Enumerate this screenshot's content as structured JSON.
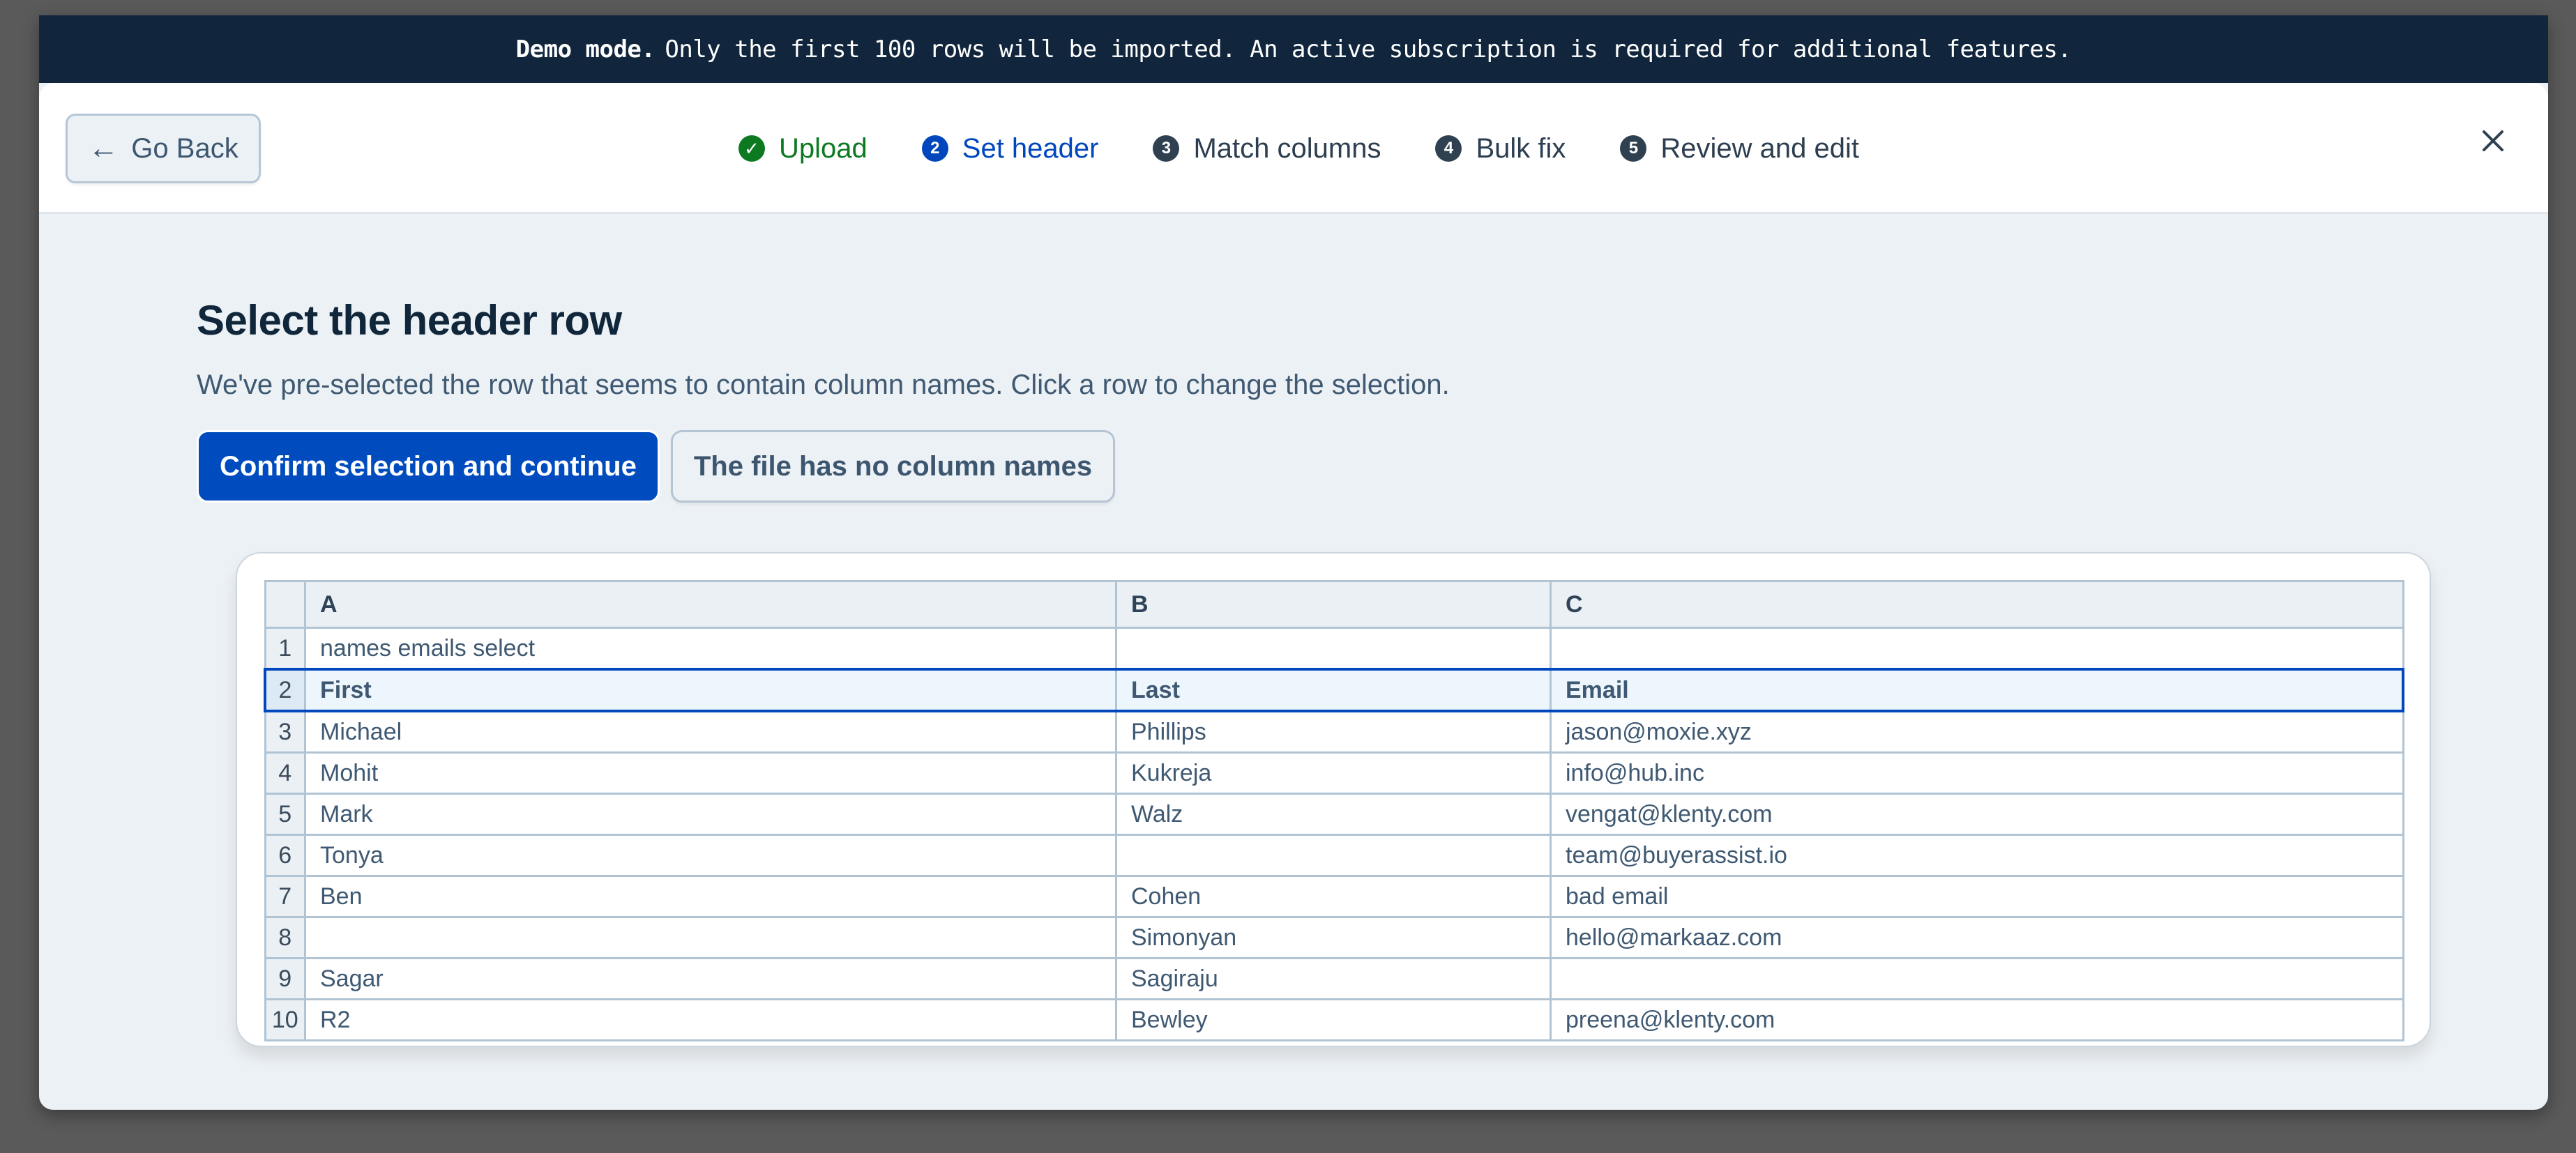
{
  "banner": {
    "bold": "Demo mode.",
    "text": "Only the first 100 rows will be imported. An active subscription is required for additional features."
  },
  "header": {
    "back_button": {
      "label": "Go Back",
      "icon": "arrow-left-icon"
    },
    "close_button": {
      "icon": "close-icon"
    },
    "steps": [
      {
        "number": "1",
        "label": "Upload",
        "status": "done",
        "icon": "check-circle-icon"
      },
      {
        "number": "2",
        "label": "Set header",
        "status": "active"
      },
      {
        "number": "3",
        "label": "Match columns",
        "status": "todo"
      },
      {
        "number": "4",
        "label": "Bulk fix",
        "status": "todo"
      },
      {
        "number": "5",
        "label": "Review and edit",
        "status": "todo"
      }
    ]
  },
  "main": {
    "title": "Select the header row",
    "subtitle": "We've pre-selected the row that seems to contain column names. Click a row to change the selection.",
    "confirm_button": "Confirm selection and continue",
    "no_header_button": "The file has no column names"
  },
  "grid": {
    "columns": [
      "A",
      "B",
      "C"
    ],
    "selected_row": 2,
    "rows": [
      {
        "num": "1",
        "cells": [
          "names emails select",
          "",
          ""
        ]
      },
      {
        "num": "2",
        "cells": [
          "First",
          "Last",
          "Email"
        ]
      },
      {
        "num": "3",
        "cells": [
          "Michael",
          "Phillips",
          "jason@moxie.xyz"
        ]
      },
      {
        "num": "4",
        "cells": [
          "Mohit",
          "Kukreja",
          "info@hub.inc"
        ]
      },
      {
        "num": "5",
        "cells": [
          "Mark",
          "Walz",
          "vengat@klenty.com"
        ]
      },
      {
        "num": "6",
        "cells": [
          "Tonya",
          "",
          "team@buyerassist.io"
        ]
      },
      {
        "num": "7",
        "cells": [
          "Ben",
          "Cohen",
          "bad email"
        ]
      },
      {
        "num": "8",
        "cells": [
          "",
          "Simonyan",
          "hello@markaaz.com"
        ]
      },
      {
        "num": "9",
        "cells": [
          "Sagar",
          "Sagiraju",
          ""
        ]
      },
      {
        "num": "10",
        "cells": [
          "R2",
          "Bewley",
          "preena@klenty.com"
        ]
      }
    ]
  },
  "colors": {
    "banner_bg": "#11263c",
    "primary": "#004cbf",
    "success": "#0d7a22",
    "page_bg": "#ecf1f5"
  }
}
